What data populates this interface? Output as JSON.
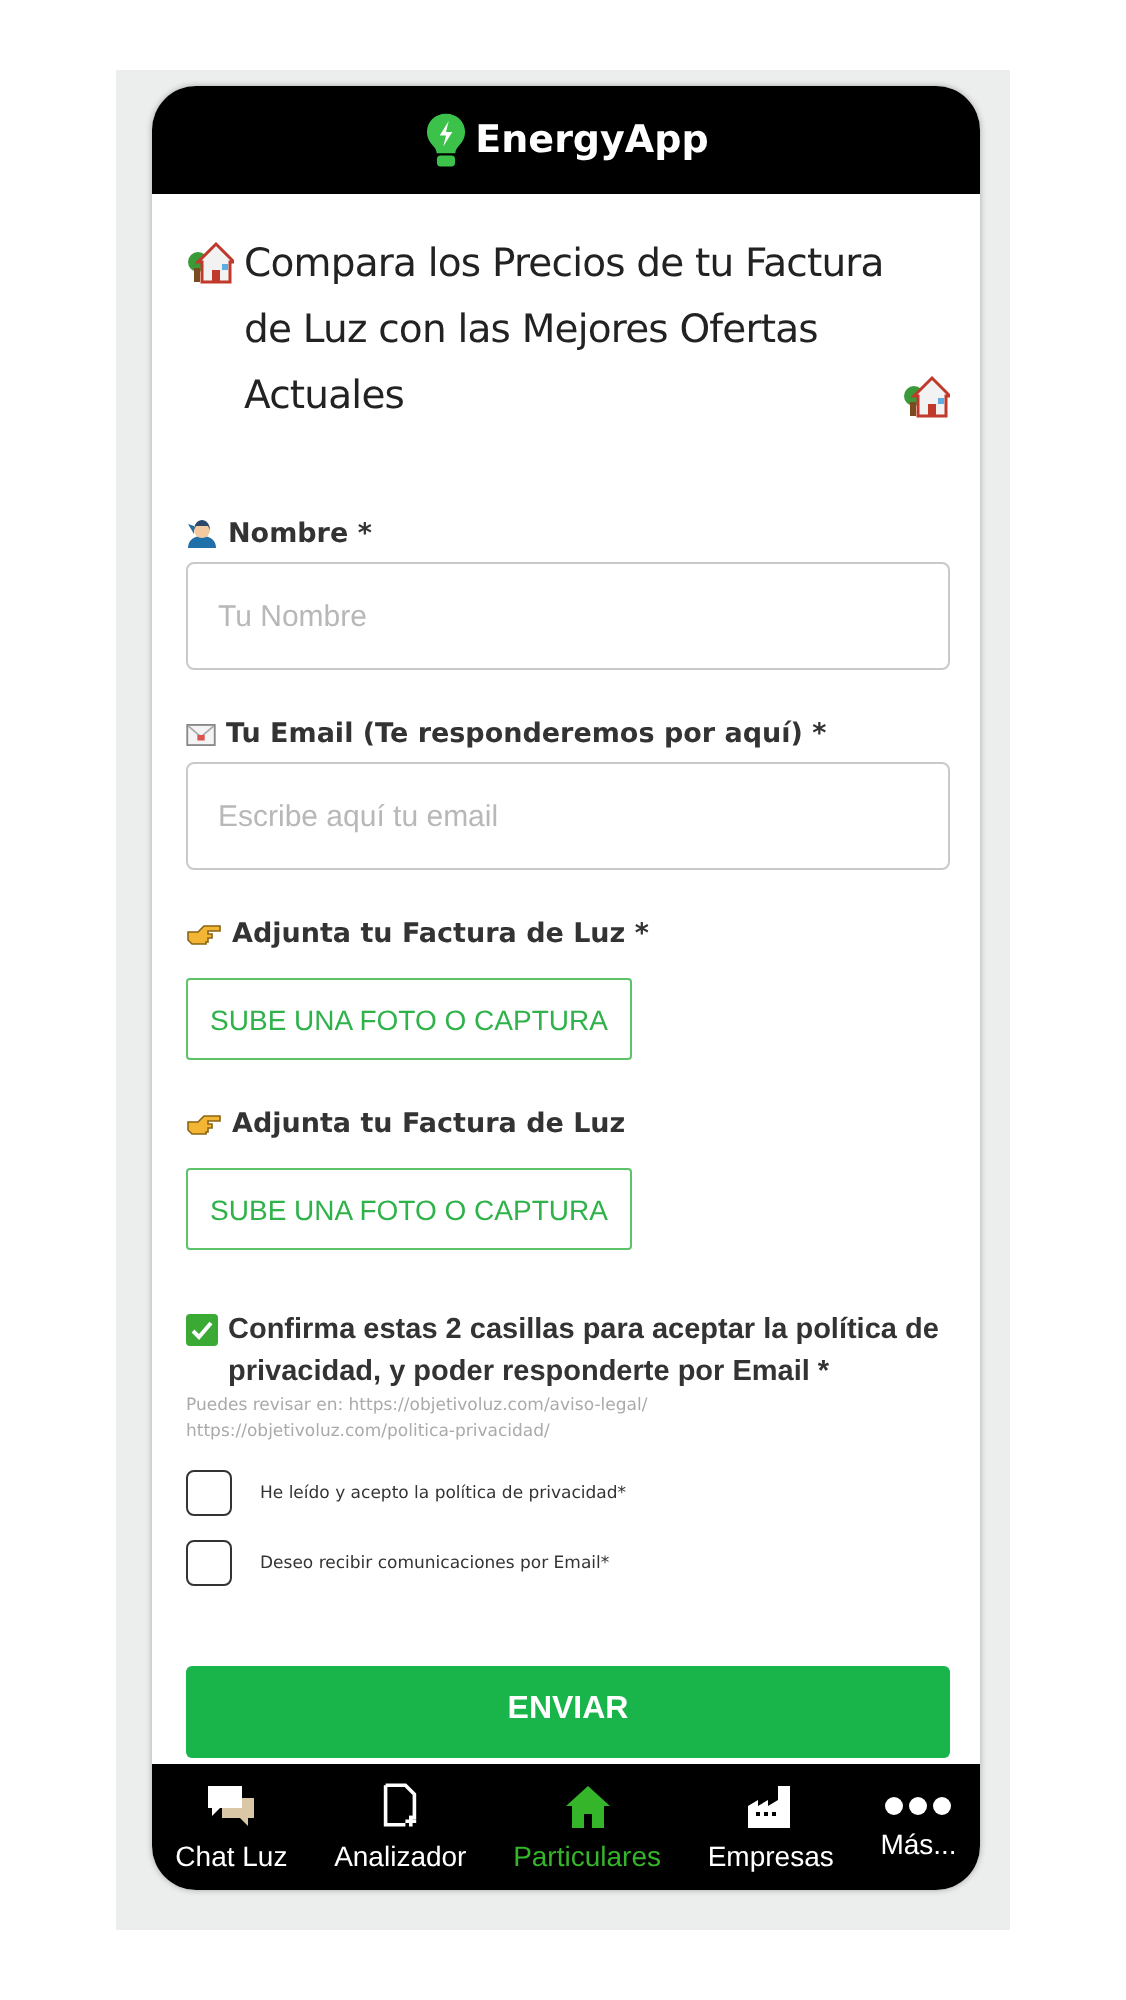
{
  "header": {
    "title": "EnergyApp"
  },
  "heading": "Compara los Precios de tu Factura de Luz con las Mejores Ofertas Actuales",
  "fields": [
    {
      "kind": "name",
      "label": "Nombre *",
      "placeholder": "Tu Nombre"
    },
    {
      "kind": "email",
      "label": "Tu Email (Te responderemos por aquí) *",
      "placeholder": "Escribe aquí tu email"
    },
    {
      "kind": "upload",
      "label": "Adjunta tu Factura de Luz *",
      "button": "SUBE UNA FOTO O CAPTURA"
    },
    {
      "kind": "upload",
      "label": "Adjunta tu Factura de Luz",
      "button": "SUBE UNA FOTO O CAPTURA"
    }
  ],
  "consent": {
    "title": "Confirma estas 2 casillas para aceptar la política de privacidad, y poder responderte por Email *",
    "note_lines": [
      "Puedes revisar en: https://objetivoluz.com/aviso-legal/",
      "https://objetivoluz.com/politica-privacidad/"
    ],
    "checkboxes": [
      {
        "label": "He leído y acepto la política de privacidad*",
        "checked": false
      },
      {
        "label": "Deseo recibir comunicaciones por Email*",
        "checked": false
      }
    ]
  },
  "submit": "ENVIAR",
  "nav": [
    {
      "kind": "chat",
      "label": "Chat Luz",
      "selected": false
    },
    {
      "kind": "document",
      "label": "Analizador",
      "selected": false
    },
    {
      "kind": "home",
      "label": "Particulares",
      "selected": true
    },
    {
      "kind": "factory",
      "label": "Empresas",
      "selected": false
    },
    {
      "kind": "more",
      "label": "Más...",
      "selected": false
    }
  ]
}
